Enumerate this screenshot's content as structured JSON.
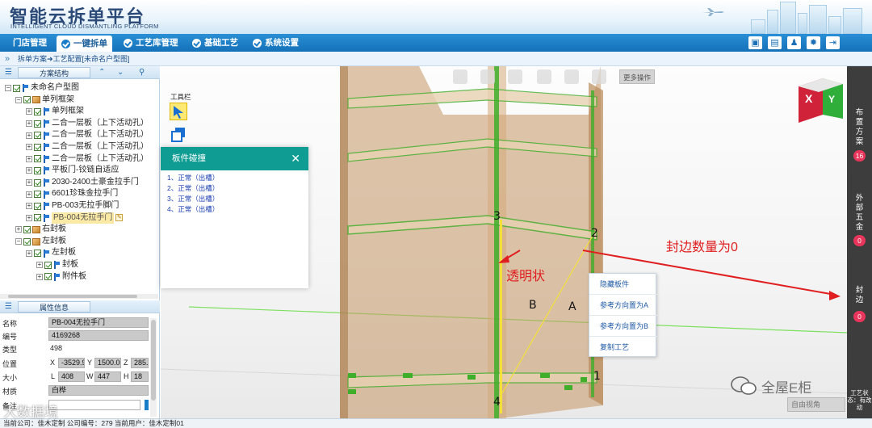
{
  "header": {
    "title": "智能云拆单平台",
    "subtitle": "INTELLIGENT CLOUD DISMANTLING PLATFORM"
  },
  "nav": {
    "items": [
      "门店管理",
      "一键拆单",
      "工艺库管理",
      "基础工艺",
      "系统设置"
    ],
    "active": "一键拆单"
  },
  "breadcrumb": {
    "text": "拆单方案➜工艺配置[未命名户型图]"
  },
  "left_panel": {
    "tree_header": "方案结构",
    "tree": [
      {
        "label": "未命名户型图",
        "level": 0,
        "icon": "flag-icon"
      },
      {
        "label": "单列框架",
        "level": 1,
        "icon": "box-icon"
      },
      {
        "label": "单列框架",
        "level": 2,
        "icon": "flag-icon"
      },
      {
        "label": "二合一层板（上下活动孔）",
        "level": 2,
        "icon": "flag-icon"
      },
      {
        "label": "二合一层板（上下活动孔）",
        "level": 2,
        "icon": "flag-icon"
      },
      {
        "label": "二合一层板（上下活动孔）",
        "level": 2,
        "icon": "flag-icon"
      },
      {
        "label": "二合一层板（上下活动孔）",
        "level": 2,
        "icon": "flag-icon"
      },
      {
        "label": "平板门-铰链自适应",
        "level": 2,
        "icon": "flag-icon"
      },
      {
        "label": "2030-2400土豪金拉手门",
        "level": 2,
        "icon": "flag-icon"
      },
      {
        "label": "6601珍珠金拉手门",
        "level": 2,
        "icon": "flag-icon"
      },
      {
        "label": "PB-003无拉手脚门",
        "level": 2,
        "icon": "flag-icon"
      },
      {
        "label": "PB-004无拉手门",
        "level": 2,
        "icon": "flag-icon",
        "selected": true
      },
      {
        "label": "右封板",
        "level": 1,
        "icon": "box-icon"
      },
      {
        "label": "左封板",
        "level": 1,
        "icon": "box-icon"
      },
      {
        "label": "左封板",
        "level": 2,
        "icon": "flag-icon"
      },
      {
        "label": "封板",
        "level": 3,
        "icon": "flag-icon"
      },
      {
        "label": "附件板",
        "level": 3,
        "icon": "flag-icon"
      }
    ],
    "props_header": "属性信息",
    "props": {
      "name_label": "名称",
      "name_value": "PB-004无拉手门",
      "code_label": "编号",
      "code_value": "4169268",
      "type_label": "类型",
      "type_value": "498",
      "pos_label": "位置",
      "pos_x": "-3529.9",
      "pos_y": "1500.0",
      "pos_z": "285.5",
      "size_label": "大小",
      "size_l": "408",
      "size_w": "447",
      "size_h": "18",
      "material_label": "材质",
      "material_value": "白桦",
      "note_label": "备注",
      "note_value": "",
      "x": "X",
      "y": "Y",
      "z": "Z",
      "l": "L",
      "w": "W",
      "h": "H"
    }
  },
  "status_bar": {
    "text": "当前公司：佳木定制   公司编号：279   当前用户：佳木定制01"
  },
  "viewport": {
    "toolbar_label": "工具栏",
    "more_ops": "更多操作",
    "view_select": "自由视角",
    "corner_labels": [
      "1",
      "2",
      "3",
      "4"
    ],
    "side_labels": [
      "A",
      "B"
    ],
    "annotation_transparent": "透明状",
    "annotation_edge_count": "封边数量为0"
  },
  "collision_panel": {
    "title": "板件碰撞",
    "items": [
      "1、正常（出槽）",
      "2、正常（出槽）",
      "3、正常（出槽）",
      "4、正常（出槽）"
    ]
  },
  "context_menu": {
    "items": [
      "隐藏板件",
      "参考方向置为A",
      "参考方向置为B",
      "复制工艺"
    ]
  },
  "right_sidebar": {
    "sections": [
      {
        "label": "布置方案",
        "badge": "16"
      },
      {
        "label": "外部五金",
        "badge": "0"
      },
      {
        "label": "封边",
        "badge": "0"
      }
    ],
    "bottom_label": "工艺状态：有改动"
  },
  "watermarks": {
    "right": "全屋E柜",
    "left": "大数据境"
  },
  "colors": {
    "nav_blue": "#1a7dc8",
    "teal_header": "#0f9d93",
    "annotation_red": "#e02020",
    "badge_pink": "#e8355b",
    "cabinet_brown": "#c49766",
    "edge_green": "#3fae2a"
  }
}
